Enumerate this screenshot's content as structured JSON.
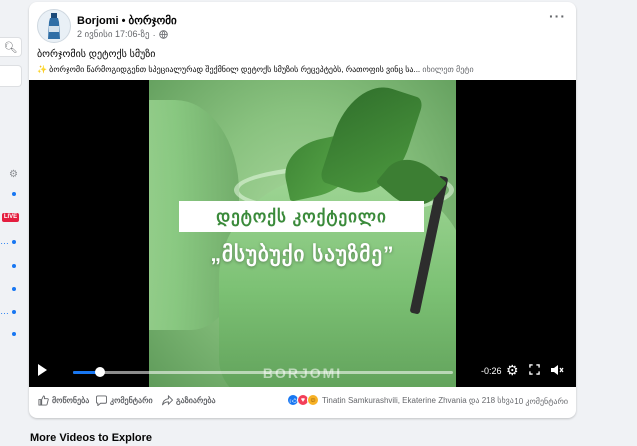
{
  "post": {
    "page_name": "Borjomi • ბორჯომი",
    "timestamp": "2 ივნისი 17:06-ზე",
    "meta_sep": "·",
    "title": "ბორჯომის დეტოქს სმუზი",
    "description": "✨ ბორჯომი წარმოგიდგენთ სპეციალურად შექმნილ დეტოქს სმუზის რეცეპტებს, რათოფის ვინც სა...",
    "see_more": "იხილეთ მეტი"
  },
  "video": {
    "title_line1": "დეტოქს კოქტეილი",
    "title_line2": "„მსუბუქი საუზმე”",
    "watermark": "BORJOMI",
    "time_remaining": "-0:26",
    "progress": 0.07
  },
  "actions": {
    "like": "მოწონება",
    "comment": "კომენტარი",
    "share": "გაზიარება",
    "reactions_text": "Tinatin Samkurashvili, Ekaterine Zhvania და 218 სხვა",
    "comments_count": "10 კომენტარი"
  },
  "section": {
    "more_videos": "More Videos to Explore"
  },
  "rail": {
    "live_label": "LIVE"
  },
  "colors": {
    "accent": "#1877f2",
    "live": "#e41e3f",
    "video_title_text": "#3a8a3a"
  }
}
